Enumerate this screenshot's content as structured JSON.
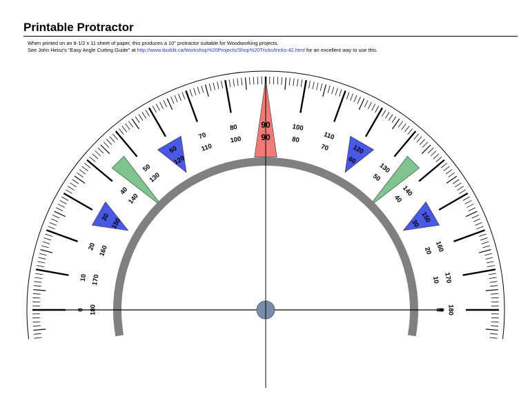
{
  "header": {
    "title": "Printable Protractor",
    "line1": "When printed on an 8-1/2 x 11 sheet of paper, this produces a 10\" protractor suitable for Woodworking projects.",
    "line2_prefix": "See John Heisz's \"Easy Angle Cutting Guide\" at ",
    "line2_link": "http://www.ibuildit.ca/Workshop%20Projects/Shop%20Tricks/tricks-42.html",
    "line2_suffix": " for an excellent way to use this."
  },
  "protractor": {
    "major_step_degrees": 10,
    "minor_step_degrees": 1,
    "outer_scale_labels": [
      "180",
      "170",
      "160",
      "150",
      "140",
      "130",
      "120",
      "110",
      "100",
      "90",
      "80",
      "70",
      "60",
      "50",
      "40",
      "30",
      "20",
      "10",
      "0"
    ],
    "inner_scale_labels": [
      "0",
      "10",
      "20",
      "30",
      "40",
      "50",
      "60",
      "70",
      "80",
      "90",
      "100",
      "110",
      "120",
      "130",
      "140",
      "150",
      "160",
      "170",
      "180"
    ],
    "markers": [
      {
        "type": "red-pointer",
        "angle": 90
      },
      {
        "type": "blue-pointer",
        "angle": 30
      },
      {
        "type": "blue-pointer",
        "angle": 60
      },
      {
        "type": "blue-pointer",
        "angle": 120
      },
      {
        "type": "blue-pointer",
        "angle": 150
      },
      {
        "type": "green-pointer",
        "angle": 45
      },
      {
        "type": "green-pointer",
        "angle": 135
      }
    ],
    "colors": {
      "red_pointer": "#f07a76",
      "blue_pointer": "#4a58e6",
      "green_pointer": "#7fc48e",
      "inner_arc": "#808080",
      "center_dot": "#7a8cac"
    }
  }
}
